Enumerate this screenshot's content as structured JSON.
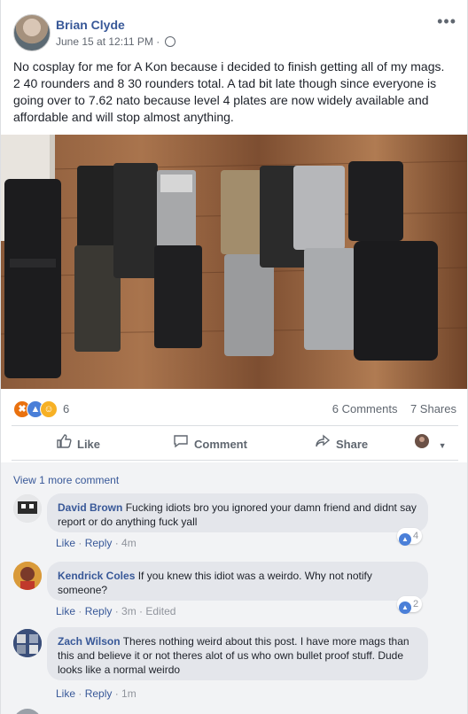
{
  "post": {
    "author": "Brian Clyde",
    "timestamp": "June 15 at 12:11 PM",
    "privacy_icon": "globe-icon",
    "text": "No cosplay for me for A Kon because i decided to finish getting all of my mags. 2 40 rounders and 8 30 rounders total. A tad bit late though since everyone is going over to 7.62 nato because level 4 plates are now widely available and affordable and will stop almost anything.",
    "reaction_count": "6",
    "comments_count": "6 Comments",
    "shares_count": "7 Shares"
  },
  "actions": {
    "like": "Like",
    "comment": "Comment",
    "share": "Share"
  },
  "comments": {
    "view_more": "View 1 more comment",
    "items": [
      {
        "author": "David Brown",
        "text": "Fucking idiots bro you ignored your damn friend and didnt say report or do anything fuck yall",
        "like": "Like",
        "reply": "Reply",
        "time": "4m",
        "edited": "",
        "reactions": "4"
      },
      {
        "author": "Kendrick Coles",
        "text": "If you knew this idiot was a weirdo. Why not notify someone?",
        "like": "Like",
        "reply": "Reply",
        "time": "3m",
        "edited": "Edited",
        "reactions": "2"
      },
      {
        "author": "Zach Wilson",
        "text": "Theres nothing weird about this post. I have more mags than this and believe it or not theres alot of us who own bullet proof stuff. Dude looks like a normal weirdo",
        "like": "Like",
        "reply": "Reply",
        "time": "1m",
        "edited": "",
        "reactions": ""
      }
    ]
  },
  "colors": {
    "link_blue": "#385898",
    "meta_gray": "#616770",
    "comment_bg": "#f2f3f5",
    "bubble_bg": "#e4e6eb"
  }
}
